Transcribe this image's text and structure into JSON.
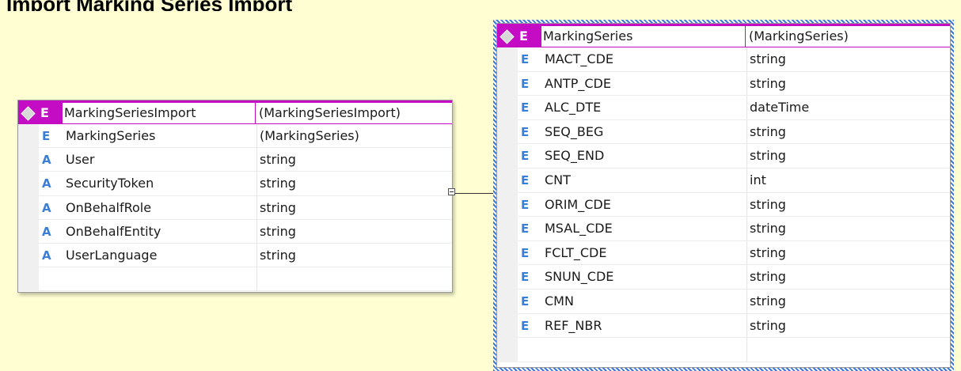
{
  "heading": "Import Marking Series Import",
  "left_table": {
    "header": {
      "name": "MarkingSeriesImport",
      "type": "(MarkingSeriesImport)",
      "kind": "E"
    },
    "rows": [
      {
        "kind": "E",
        "name": "MarkingSeries",
        "type": "(MarkingSeries)"
      },
      {
        "kind": "A",
        "name": "User",
        "type": "string"
      },
      {
        "kind": "A",
        "name": "SecurityToken",
        "type": "string"
      },
      {
        "kind": "A",
        "name": "OnBehalfRole",
        "type": "string"
      },
      {
        "kind": "A",
        "name": "OnBehalfEntity",
        "type": "string"
      },
      {
        "kind": "A",
        "name": "UserLanguage",
        "type": "string"
      }
    ]
  },
  "right_table": {
    "header": {
      "name": "MarkingSeries",
      "type": "(MarkingSeries)",
      "kind": "E"
    },
    "rows": [
      {
        "kind": "E",
        "name": "MACT_CDE",
        "type": "string"
      },
      {
        "kind": "E",
        "name": "ANTP_CDE",
        "type": "string"
      },
      {
        "kind": "E",
        "name": "ALC_DTE",
        "type": "dateTime"
      },
      {
        "kind": "E",
        "name": "SEQ_BEG",
        "type": "string"
      },
      {
        "kind": "E",
        "name": "SEQ_END",
        "type": "string"
      },
      {
        "kind": "E",
        "name": "CNT",
        "type": "int"
      },
      {
        "kind": "E",
        "name": "ORIM_CDE",
        "type": "string"
      },
      {
        "kind": "E",
        "name": "MSAL_CDE",
        "type": "string"
      },
      {
        "kind": "E",
        "name": "FCLT_CDE",
        "type": "string"
      },
      {
        "kind": "E",
        "name": "SNUN_CDE",
        "type": "string"
      },
      {
        "kind": "E",
        "name": "CMN",
        "type": "string"
      },
      {
        "kind": "E",
        "name": "REF_NBR",
        "type": "string"
      }
    ]
  },
  "colors": {
    "header_accent": "#c40cc4",
    "kind_icon": "#3a7fd5",
    "background": "#fefed2",
    "selection_border": "#3b78d8"
  }
}
